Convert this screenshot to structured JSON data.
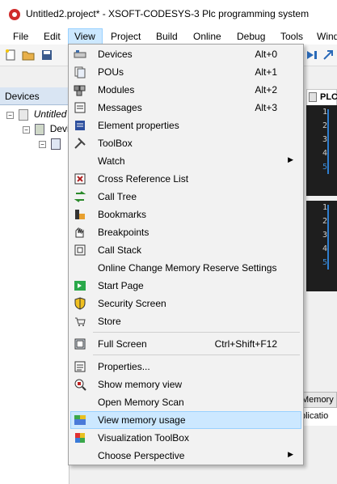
{
  "window": {
    "title": "Untitled2.project* - XSOFT-CODESYS-3 Plc programming system"
  },
  "menubar": {
    "items": [
      "File",
      "Edit",
      "View",
      "Project",
      "Build",
      "Online",
      "Debug",
      "Tools",
      "Windo"
    ]
  },
  "devices_panel": {
    "header": "Devices",
    "tree": [
      "Untitled",
      "Devi"
    ]
  },
  "editor": {
    "tab_label": "PLC",
    "line_numbers_top": [
      "1",
      "2",
      "3",
      "4",
      "5"
    ],
    "line_numbers_bottom": [
      "1",
      "2",
      "3",
      "4",
      "5"
    ],
    "bottom_tab_label": "Memory Us",
    "bottom_tab2_label": "plicatio"
  },
  "view_menu": {
    "items": [
      {
        "label": "Devices",
        "shortcut": "Alt+0",
        "icon": "devices-icon"
      },
      {
        "label": "POUs",
        "shortcut": "Alt+1",
        "icon": "pous-icon"
      },
      {
        "label": "Modules",
        "shortcut": "Alt+2",
        "icon": "modules-icon"
      },
      {
        "label": "Messages",
        "shortcut": "Alt+3",
        "icon": "messages-icon"
      },
      {
        "label": "Element properties",
        "shortcut": "",
        "icon": "element-properties-icon"
      },
      {
        "label": "ToolBox",
        "shortcut": "",
        "icon": "toolbox-icon"
      },
      {
        "label": "Watch",
        "shortcut": "",
        "icon": "",
        "submenu": true
      },
      {
        "label": "Cross Reference List",
        "shortcut": "",
        "icon": "cross-reference-icon"
      },
      {
        "label": "Call Tree",
        "shortcut": "",
        "icon": "call-tree-icon"
      },
      {
        "label": "Bookmarks",
        "shortcut": "",
        "icon": "bookmarks-icon"
      },
      {
        "label": "Breakpoints",
        "shortcut": "",
        "icon": "breakpoints-icon"
      },
      {
        "label": "Call Stack",
        "shortcut": "",
        "icon": "call-stack-icon"
      },
      {
        "label": "Online Change Memory Reserve Settings",
        "shortcut": "",
        "icon": ""
      },
      {
        "label": "Start Page",
        "shortcut": "",
        "icon": "start-page-icon"
      },
      {
        "label": "Security Screen",
        "shortcut": "",
        "icon": "security-icon"
      },
      {
        "label": "Store",
        "shortcut": "",
        "icon": "store-icon"
      },
      {
        "label": "Full Screen",
        "shortcut": "Ctrl+Shift+F12",
        "icon": "full-screen-icon"
      },
      {
        "label": "Properties...",
        "shortcut": "",
        "icon": "properties-icon"
      },
      {
        "label": "Show memory view",
        "shortcut": "",
        "icon": "memory-view-icon"
      },
      {
        "label": "Open Memory Scan",
        "shortcut": "",
        "icon": ""
      },
      {
        "label": "View memory usage",
        "shortcut": "",
        "icon": "memory-usage-icon",
        "highlighted": true
      },
      {
        "label": "Visualization ToolBox",
        "shortcut": "",
        "icon": "visualization-toolbox-icon"
      },
      {
        "label": "Choose Perspective",
        "shortcut": "",
        "icon": "",
        "submenu": true
      }
    ]
  },
  "colors": {
    "menu_highlight": "#cce8ff",
    "menu_highlight_border": "#99d1ff",
    "panel_header": "#d9e5f3",
    "code_background": "#1e1e1e"
  }
}
